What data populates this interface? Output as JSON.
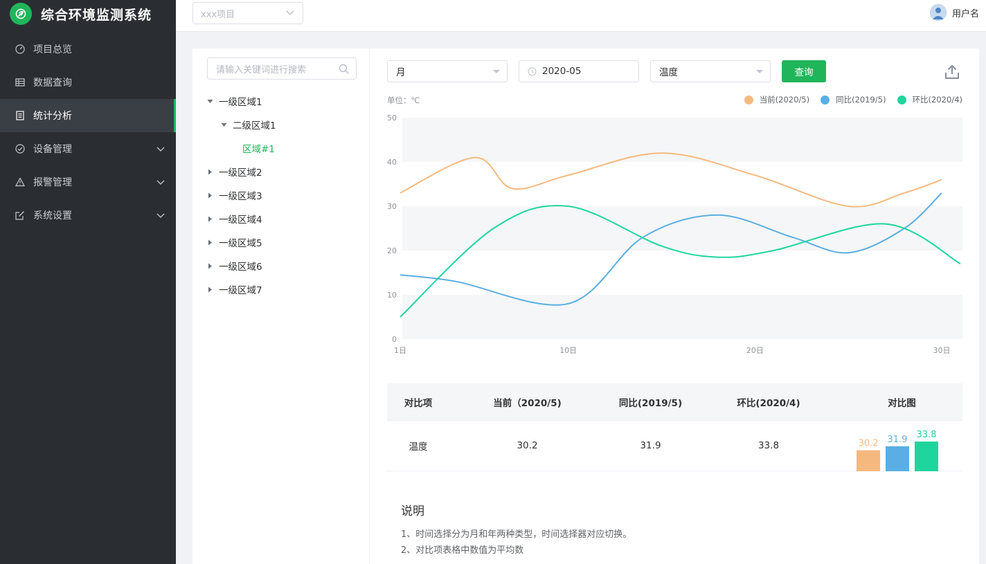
{
  "app": {
    "title": "综合环境监测系统",
    "accent": "#21b55b"
  },
  "sidebar": {
    "items": [
      {
        "label": "项目总览",
        "icon": "dashboard-icon",
        "expandable": false,
        "active": false
      },
      {
        "label": "数据查询",
        "icon": "table-icon",
        "expandable": false,
        "active": false
      },
      {
        "label": "统计分析",
        "icon": "document-icon",
        "expandable": false,
        "active": true
      },
      {
        "label": "设备管理",
        "icon": "check-circle-icon",
        "expandable": true,
        "active": false
      },
      {
        "label": "报警管理",
        "icon": "warning-icon",
        "expandable": true,
        "active": false
      },
      {
        "label": "系统设置",
        "icon": "edit-icon",
        "expandable": true,
        "active": false
      }
    ]
  },
  "topbar": {
    "project_placeholder": "xxx项目",
    "username": "用户名"
  },
  "tree": {
    "search_placeholder": "请输入关键词进行搜索",
    "nodes": [
      {
        "label": "一级区域1",
        "level": 1,
        "expanded": true
      },
      {
        "label": "二级区域1",
        "level": 2,
        "expanded": true
      },
      {
        "label": "区域#1",
        "level": 3,
        "leaf": true
      },
      {
        "label": "一级区域2",
        "level": 1,
        "expanded": false
      },
      {
        "label": "一级区域3",
        "level": 1,
        "expanded": false
      },
      {
        "label": "一级区域4",
        "level": 1,
        "expanded": false
      },
      {
        "label": "一级区域5",
        "level": 1,
        "expanded": false
      },
      {
        "label": "一级区域6",
        "level": 1,
        "expanded": false
      },
      {
        "label": "一级区域7",
        "level": 1,
        "expanded": false
      }
    ]
  },
  "filters": {
    "period_value": "月",
    "date_value": "2020-05",
    "metric_value": "温度",
    "query_label": "查询"
  },
  "chart_data": {
    "type": "line",
    "unit_label": "单位：℃",
    "x": [
      1,
      5,
      7,
      10,
      15,
      18,
      20,
      24,
      27,
      30,
      31
    ],
    "x_ticks": [
      1,
      10,
      20,
      30
    ],
    "x_tick_labels": [
      "1日",
      "10日",
      "20日",
      "30日"
    ],
    "ylim": [
      0,
      50
    ],
    "y_ticks": [
      0,
      10,
      20,
      30,
      40,
      50
    ],
    "grid": "alternating-bands",
    "legend_position": "top-right",
    "series": [
      {
        "name": "当前(2020/5)",
        "color": "#f5b97f",
        "points": [
          [
            1,
            33
          ],
          [
            5,
            41
          ],
          [
            7,
            34
          ],
          [
            10,
            37
          ],
          [
            15,
            42
          ],
          [
            20,
            37
          ],
          [
            25,
            30
          ],
          [
            28,
            33
          ],
          [
            30,
            36
          ]
        ]
      },
      {
        "name": "同比(2019/5)",
        "color": "#5aaee4",
        "points": [
          [
            1,
            14.5
          ],
          [
            4,
            13
          ],
          [
            10,
            8
          ],
          [
            14,
            23
          ],
          [
            18,
            28
          ],
          [
            22,
            23
          ],
          [
            25,
            19.5
          ],
          [
            28,
            25
          ],
          [
            30,
            33
          ]
        ]
      },
      {
        "name": "环比(2020/4)",
        "color": "#1ed69d",
        "points": [
          [
            1,
            5
          ],
          [
            6,
            25
          ],
          [
            10,
            30
          ],
          [
            15,
            21
          ],
          [
            18,
            18.5
          ],
          [
            21,
            20
          ],
          [
            27,
            26
          ],
          [
            31,
            17
          ]
        ]
      }
    ]
  },
  "table": {
    "headers": [
      "对比项",
      "当前（2020/5)",
      "同比(2019/5)",
      "环比(2020/4)",
      "对比图"
    ],
    "row": {
      "item": "温度",
      "current": "30.2",
      "yoy": "31.9",
      "mom": "33.8"
    },
    "minibars": [
      {
        "label": "30.2",
        "value": 30.2,
        "color": "#f5b97f"
      },
      {
        "label": "31.9",
        "value": 31.9,
        "color": "#5aaee4"
      },
      {
        "label": "33.8",
        "value": 33.8,
        "color": "#1ed69d"
      }
    ]
  },
  "notes": {
    "title": "说明",
    "lines": [
      "1、时间选择分为月和年两种类型，时间选择器对应切换。",
      "2、对比项表格中数值为平均数"
    ]
  }
}
